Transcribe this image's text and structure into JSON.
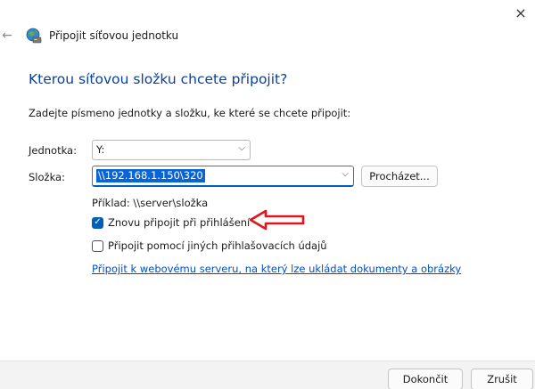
{
  "window": {
    "title": "Připojit síťovou jednotku",
    "close_glyph": "×",
    "back_glyph": "←",
    "title_icon": "network-drive-icon"
  },
  "main": {
    "heading": "Kterou síťovou složku chcete připojit?",
    "instruction": "Zadejte písmeno jednotky a složku, ke které se chcete připojit:"
  },
  "form": {
    "drive_label": "Jednotka:",
    "drive_value": "Y:",
    "folder_label": "Složka:",
    "folder_value": "\\\\192.168.1.150\\320",
    "browse_label": "Procházet...",
    "example_text": "Příklad: \\\\server\\složka",
    "reconnect_label": "Znovu připojit při přihlášení",
    "reconnect_checked": true,
    "other_credentials_label": "Připojit pomocí jiných přihlašovacích údajů",
    "other_credentials_checked": false,
    "web_link_text": "Připojit k webovému serveru, na který lze ukládat dokumenty a obrázky"
  },
  "footer": {
    "finish_label": "Dokončit",
    "cancel_label": "Zrušit"
  },
  "colors": {
    "heading": "#0a3fa0",
    "accent": "#005fb8",
    "link": "#0050c8",
    "annotation_arrow": "#e0141e"
  }
}
